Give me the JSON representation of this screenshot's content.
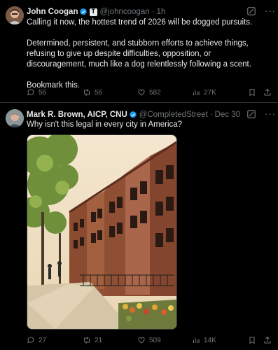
{
  "tweet1": {
    "name": "John Coogan",
    "handle": "@johncoogan",
    "separator": "·",
    "time": "1h",
    "paragraphs": [
      "Calling it now, the hottest trend of 2026 will be dogged pursuits.",
      "Determined, persistent, and stubborn efforts to achieve things, refusing to give up despite difficulties, opposition, or discouragement, much like a dog relentlessly following a scent.",
      "Bookmark this."
    ],
    "replies": "56",
    "reposts": "56",
    "likes": "582",
    "views": "27K"
  },
  "tweet2": {
    "name": "Mark R. Brown, AICP, CNU",
    "handle": "@CompletedStreet",
    "separator": "·",
    "time": "Dec 30",
    "text": "Why isn't this legal in every city in America?",
    "image_description": "Brick rowhouse street with trees and sidewalk",
    "replies": "27",
    "reposts": "21",
    "likes": "509",
    "views": "14K"
  },
  "colors": {
    "background": "#000000",
    "text": "#e7e9ea",
    "muted": "#71767b",
    "verified": "#1d9bf0",
    "divider": "#2f3336"
  }
}
